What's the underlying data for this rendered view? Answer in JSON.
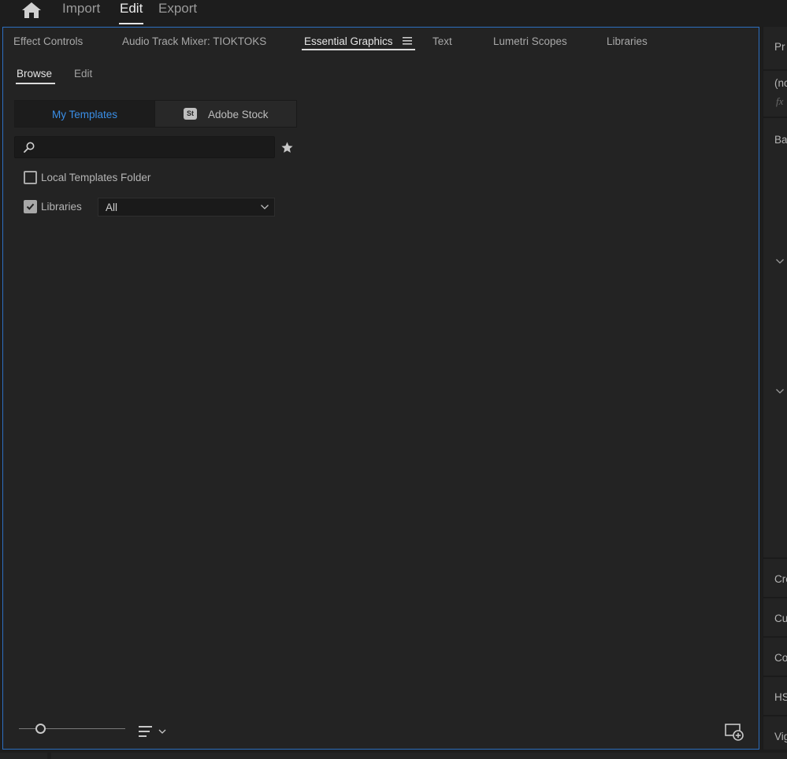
{
  "top_nav": {
    "tabs": [
      {
        "label": "Import",
        "active": false
      },
      {
        "label": "Edit",
        "active": true
      },
      {
        "label": "Export",
        "active": false
      }
    ]
  },
  "panel": {
    "tabs": [
      {
        "label": "Effect Controls",
        "active": false
      },
      {
        "label": "Audio Track Mixer: TIOKTOKS",
        "active": false
      },
      {
        "label": "Essential Graphics",
        "active": true
      },
      {
        "label": "Text",
        "active": false
      },
      {
        "label": "Lumetri Scopes",
        "active": false
      },
      {
        "label": "Libraries",
        "active": false
      }
    ],
    "sub_tabs": [
      {
        "label": "Browse",
        "active": true
      },
      {
        "label": "Edit",
        "active": false
      }
    ],
    "segments": {
      "my_templates": "My Templates",
      "adobe_stock_badge": "St",
      "adobe_stock": "Adobe Stock"
    },
    "search": {
      "value": "",
      "placeholder": ""
    },
    "local_templates": {
      "label": "Local Templates Folder",
      "checked": false
    },
    "libraries": {
      "label": "Libraries",
      "checked": true,
      "selected": "All"
    },
    "thumbnail_zoom": 0.2
  },
  "right_panel": {
    "header": "Pr",
    "no_clip": "(nc",
    "fx": "fx",
    "basic": "Ba",
    "sections": [
      "Cre",
      "Cu",
      "Co",
      "HS",
      "Vig"
    ]
  },
  "colors": {
    "accent": "#3a8ee6",
    "panel_border": "#2d6fc0",
    "panel_bg": "#232323"
  }
}
